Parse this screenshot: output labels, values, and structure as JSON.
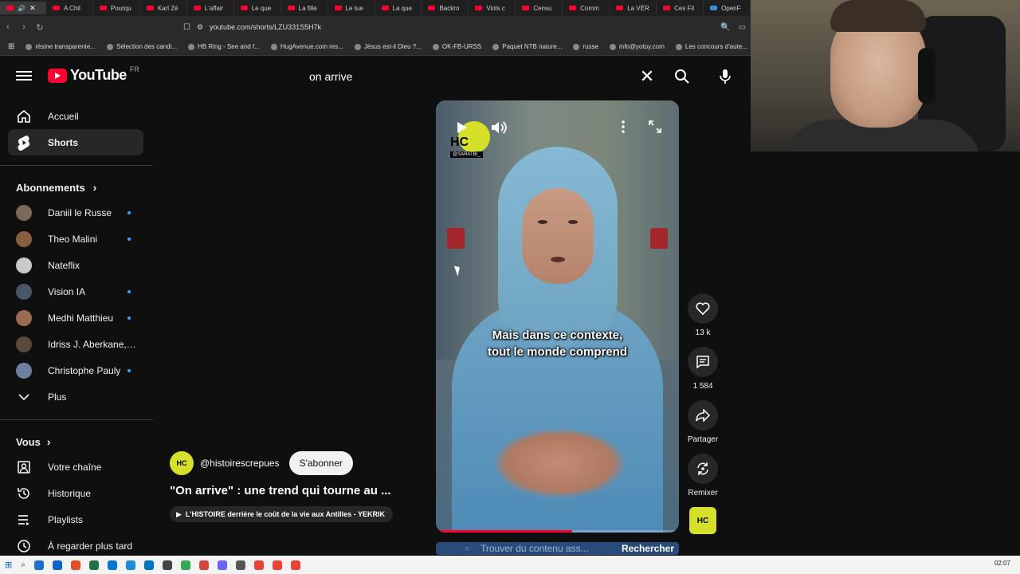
{
  "browser": {
    "tabs": [
      "A Chil",
      "Pourqu",
      "Karl Zé",
      "L'affair",
      "Le que",
      "La fille",
      "Le tue",
      "La que",
      "Backro",
      "Viols c",
      "Censu",
      "Comm",
      "La VÉR",
      "Ces Fil",
      "OpenF"
    ],
    "url": "youtube.com/shorts/LZU331S5H7k",
    "bookmarks": [
      "résine transparente...",
      "Sélection des candi...",
      "HB Ring - See and f...",
      "HugAvenue.com res...",
      "Jésus est-il Dieu ?...",
      "OK-FB-URSS",
      "Paquet NTB nature...",
      "russe",
      "info@yotoy.com",
      "Les concours d'aute..."
    ]
  },
  "header": {
    "logo": "YouTube",
    "region": "FR",
    "search_value": "on arrive"
  },
  "sidebar": {
    "main": [
      {
        "label": "Accueil",
        "icon": "home-icon"
      },
      {
        "label": "Shorts",
        "icon": "shorts-icon"
      }
    ],
    "subscriptions_title": "Abonnements",
    "subscriptions": [
      {
        "label": "Daniil le Russe",
        "color": "#7a6a5a",
        "new": true
      },
      {
        "label": "Theo Malini",
        "color": "#8a5e3c",
        "new": true
      },
      {
        "label": "Nateflix",
        "color": "#c9c9c9",
        "new": false
      },
      {
        "label": "Vision IA",
        "color": "#4a5568",
        "new": true
      },
      {
        "label": "Medhi Matthieu",
        "color": "#9b6b4f",
        "new": true
      },
      {
        "label": "Idriss J. Aberkane, ...",
        "color": "#5b4a3a",
        "new": false
      },
      {
        "label": "Christophe Pauly",
        "color": "#6f7fa0",
        "new": true
      }
    ],
    "more_label": "Plus",
    "you_title": "Vous",
    "you": [
      {
        "label": "Votre chaîne",
        "icon": "channel-icon"
      },
      {
        "label": "Historique",
        "icon": "history-icon"
      },
      {
        "label": "Playlists",
        "icon": "playlists-icon"
      },
      {
        "label": "À regarder plus tard",
        "icon": "watch-later-icon"
      }
    ]
  },
  "short": {
    "caption_line1": "Mais dans ce contexte,",
    "caption_line2": "tout le monde comprend",
    "overlay_logo": "HC",
    "overlay_handle": "@SARATBI_",
    "progress": 0.56,
    "channel_handle": "@histoirescrepues",
    "channel_avatar": "HC",
    "subscribe_label": "S'abonner",
    "title": "\"On arrive\" : une trend qui tourne au ...",
    "related": "L'HISTOIRE derrière le coût de la vie aux Antilles - YEKRIK"
  },
  "actions": {
    "likes": "13 k",
    "comments": "1 584",
    "share_label": "Partager",
    "remix_label": "Remixer",
    "remix_thumb": "HC"
  },
  "find_bar": {
    "placeholder": "Trouver du contenu ass...",
    "button": "Rechercher"
  },
  "taskbar": {
    "clock": "02:07",
    "icon_colors": [
      "#1d6fd1",
      "#0a64c8",
      "#e44d26",
      "#217346",
      "#0078d4",
      "#1b8dd8",
      "#0072c6",
      "#444444",
      "#34a853",
      "#d64541",
      "#6c63ff",
      "#555555",
      "#ea4335",
      "#ea4335",
      "#ea4335"
    ]
  }
}
